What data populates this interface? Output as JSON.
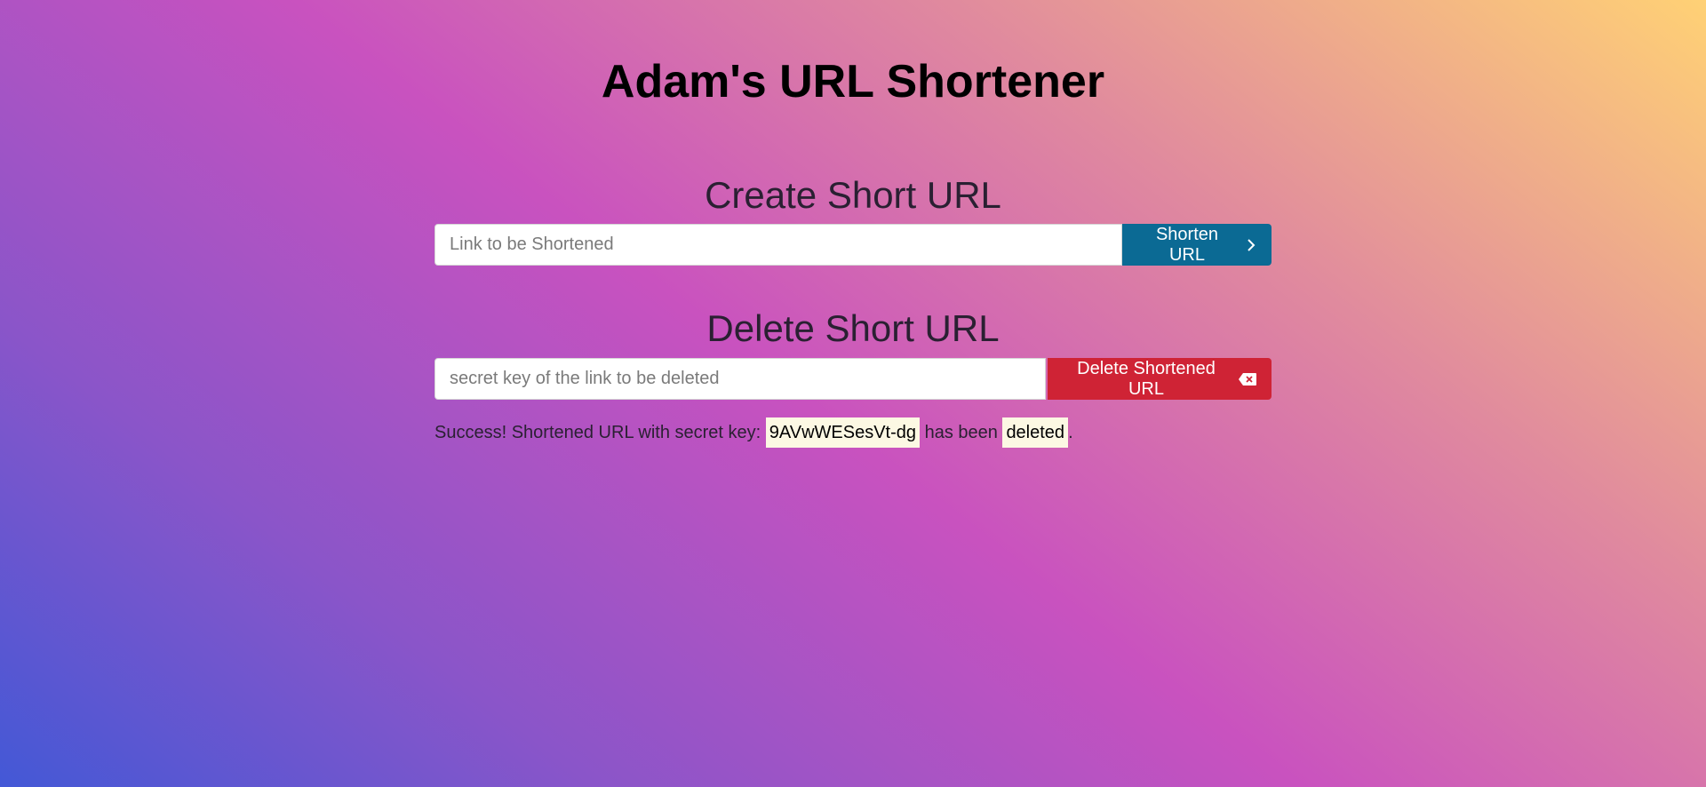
{
  "header": {
    "title": "Adam's URL Shortener"
  },
  "create": {
    "title": "Create Short URL",
    "input_placeholder": "Link to be Shortened",
    "input_value": "",
    "button_label": "Shorten URL",
    "button_icon": "chevron-right-icon",
    "button_color": "#0b6a94"
  },
  "delete": {
    "title": "Delete Short URL",
    "input_placeholder": "secret key of the link to be deleted",
    "input_value": "",
    "button_label": "Delete Shortened URL",
    "button_icon": "backspace-x-icon",
    "button_color": "#cf2335"
  },
  "status": {
    "prefix": "Success! Shortened URL with secret key: ",
    "secret_key": "9AVwWESesVt-dg",
    "middle": " has been ",
    "action": "deleted",
    "suffix": "."
  }
}
